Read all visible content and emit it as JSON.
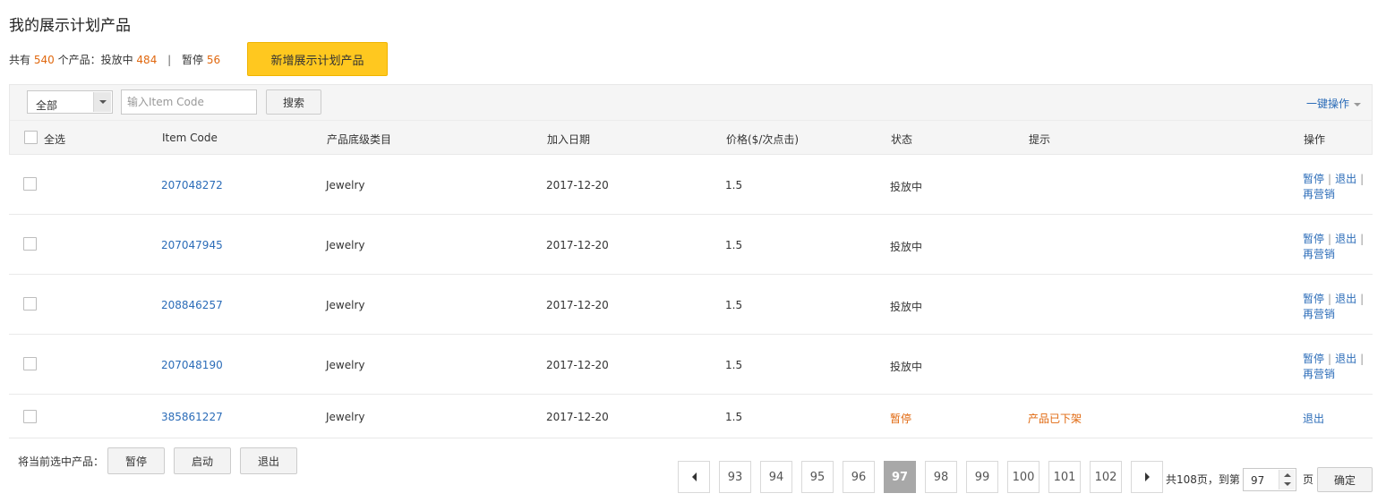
{
  "page": {
    "title": "我的展示计划产品",
    "summary": {
      "prefix": "共有",
      "total": "540",
      "mid": "个产品：投放中",
      "active": "484",
      "separator": "|",
      "paused_label": "暂停",
      "paused": "56"
    },
    "add_button": "新增展示计划产品"
  },
  "filter": {
    "select_value": "全部",
    "search_placeholder": "输入Item Code",
    "search_button": "搜索",
    "bulk_action": "一键操作"
  },
  "table": {
    "headers": {
      "select_all": "全选",
      "item_code": "Item Code",
      "category": "产品底级类目",
      "date": "加入日期",
      "price": "价格($/次点击)",
      "status": "状态",
      "hint": "提示",
      "actions": "操作"
    },
    "rows": [
      {
        "item_code": "207048272",
        "category": "Jewelry",
        "date": "2017-12-20",
        "price": "1.5",
        "status": "投放中",
        "hint": "",
        "op1": "暂停",
        "op2": "退出",
        "op3": "再营销"
      },
      {
        "item_code": "207047945",
        "category": "Jewelry",
        "date": "2017-12-20",
        "price": "1.5",
        "status": "投放中",
        "hint": "",
        "op1": "暂停",
        "op2": "退出",
        "op3": "再营销"
      },
      {
        "item_code": "208846257",
        "category": "Jewelry",
        "date": "2017-12-20",
        "price": "1.5",
        "status": "投放中",
        "hint": "",
        "op1": "暂停",
        "op2": "退出",
        "op3": "再营销"
      },
      {
        "item_code": "207048190",
        "category": "Jewelry",
        "date": "2017-12-20",
        "price": "1.5",
        "status": "投放中",
        "hint": "",
        "op1": "暂停",
        "op2": "退出",
        "op3": "再营销"
      },
      {
        "item_code": "385861227",
        "category": "Jewelry",
        "date": "2017-12-20",
        "price": "1.5",
        "status": "暂停",
        "hint": "产品已下架",
        "op1": "退出"
      }
    ]
  },
  "footer": {
    "label": "将当前选中产品：",
    "pause": "暂停",
    "start": "启动",
    "exit": "退出"
  },
  "pagination": {
    "pages": [
      "93",
      "94",
      "95",
      "96",
      "97",
      "98",
      "99",
      "100",
      "101",
      "102"
    ],
    "current": "97",
    "total_text": "共108页，到第",
    "page_input": "97",
    "page_suffix": "页",
    "confirm": "确定"
  },
  "colors": {
    "link": "#2b6cb8",
    "accent_orange": "#e0680f",
    "add_button_bg": "#ffc81f",
    "active_page_bg": "#a8a8a8"
  }
}
